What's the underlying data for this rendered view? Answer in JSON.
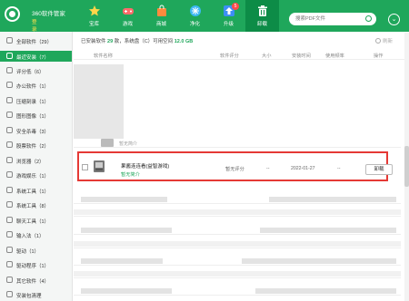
{
  "app": {
    "title": "360软件管家",
    "login": "登录"
  },
  "nav": [
    {
      "label": "宝库",
      "icon": "star-icon"
    },
    {
      "label": "游戏",
      "icon": "gamepad-icon"
    },
    {
      "label": "商城",
      "icon": "shop-bag-icon"
    },
    {
      "label": "净化",
      "icon": "purify-icon"
    },
    {
      "label": "升级",
      "icon": "upgrade-icon",
      "badge": "5"
    },
    {
      "label": "卸载",
      "icon": "trash-icon"
    }
  ],
  "search": {
    "placeholder": "搜索PDF文件"
  },
  "sidebar": [
    {
      "label": "全部软件（29）",
      "icon": "grid-icon"
    },
    {
      "label": "最近安装（7）",
      "icon": "clock-icon",
      "active": true
    },
    {
      "label": "评分低（6）",
      "icon": "thumb-down-icon"
    },
    {
      "label": "办公软件（1）",
      "icon": "office-icon"
    },
    {
      "label": "压缩刻录（1）",
      "icon": "archive-icon"
    },
    {
      "label": "图形图像（1）",
      "icon": "image-icon"
    },
    {
      "label": "安全杀毒（3）",
      "icon": "shield-icon"
    },
    {
      "label": "股票软件（2）",
      "icon": "stock-icon"
    },
    {
      "label": "浏览器（2）",
      "icon": "browser-icon"
    },
    {
      "label": "游戏娱乐（1）",
      "icon": "game-icon"
    },
    {
      "label": "系统工具（1）",
      "icon": "system-tool-icon"
    },
    {
      "label": "系统工具（8）",
      "icon": "system-tool-icon"
    },
    {
      "label": "聊天工具（1）",
      "icon": "chat-icon"
    },
    {
      "label": "输入法（1）",
      "icon": "keyboard-icon"
    },
    {
      "label": "驱动（1）",
      "icon": "driver-icon"
    },
    {
      "label": "驱动程序（1）",
      "icon": "driver-program-icon"
    },
    {
      "label": "其它软件（4）",
      "icon": "other-icon"
    },
    {
      "label": "安装包清理",
      "icon": "cleanup-icon"
    }
  ],
  "summary": {
    "prefix": "已安装软件",
    "count": "29",
    "mid": "款，系统盘（C）可用空间",
    "space": "12.0 GB"
  },
  "refresh": "刷新",
  "columns": [
    "软件名称",
    "软件评分",
    "大小",
    "安装时间",
    "使用频率",
    "操作"
  ],
  "partial_row": {
    "desc": "暂无简介"
  },
  "app_row": {
    "name": "果酱连连看(益智游戏)",
    "desc": "暂无简介",
    "rating": "暂无评分",
    "size": "--",
    "install_date": "2022-01-27",
    "frequency": "--",
    "action": "卸载"
  },
  "colors": {
    "brand_green": "#1fa75b",
    "highlight_red": "#e53935"
  }
}
